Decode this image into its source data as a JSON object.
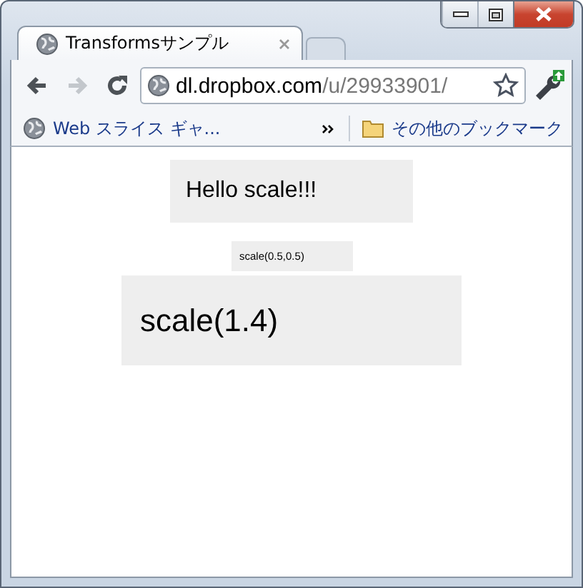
{
  "tab": {
    "title": "Transformsサンプル"
  },
  "nav": [
    {
      "kind": "back",
      "disabled": false
    },
    {
      "kind": "forward",
      "disabled": true
    },
    {
      "kind": "reload",
      "disabled": false
    }
  ],
  "address": {
    "host": "dl.dropbox.com",
    "path": "/u/29933901/"
  },
  "bookmarks": [
    {
      "kind": "page",
      "label": "Web スライス ギャ..."
    }
  ],
  "other_bookmarks": "その他のブックマーク",
  "content": [
    {
      "kind": "normal",
      "text": "Hello scale!!!"
    },
    {
      "kind": "small",
      "text": "scale(0.5,0.5)"
    },
    {
      "kind": "large",
      "text": "scale(1.4)"
    }
  ]
}
